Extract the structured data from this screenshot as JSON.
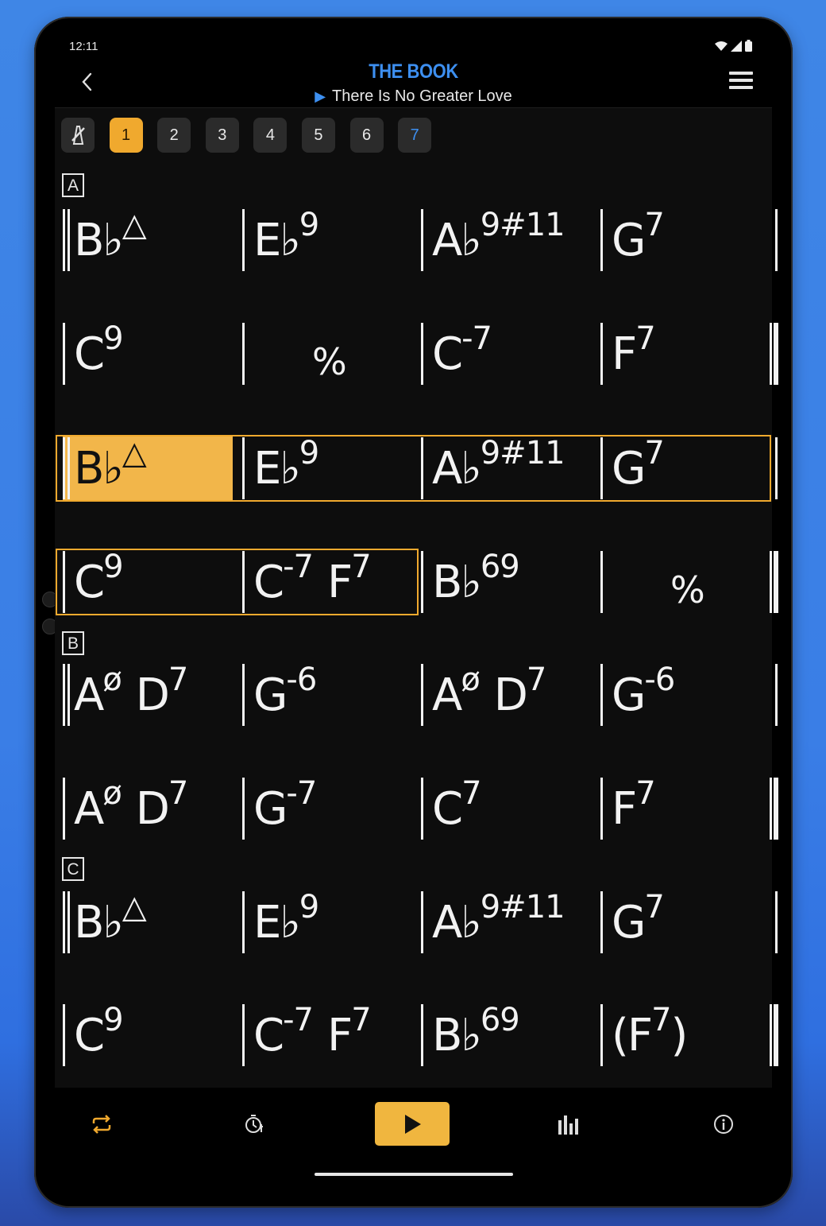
{
  "status": {
    "time": "12:11"
  },
  "header": {
    "title": "THE BOOK",
    "song_title": "There Is No Greater Love"
  },
  "tabs": [
    "1",
    "2",
    "3",
    "4",
    "5",
    "6",
    "7"
  ],
  "active_tab": "1",
  "sections": [
    {
      "label": "A",
      "rows": [
        [
          {
            "root": "Bb",
            "ext": "△"
          },
          {
            "root": "Eb",
            "ext": "9"
          },
          {
            "root": "Ab",
            "ext": "9#11"
          },
          {
            "root": "G",
            "ext": "7"
          }
        ],
        [
          {
            "root": "C",
            "ext": "9"
          },
          {
            "repeat": "%"
          },
          {
            "root": "C",
            "ext": "-7"
          },
          {
            "root": "F",
            "ext": "7"
          }
        ],
        [
          {
            "root": "Bb",
            "ext": "△"
          },
          {
            "root": "Eb",
            "ext": "9"
          },
          {
            "root": "Ab",
            "ext": "9#11"
          },
          {
            "root": "G",
            "ext": "7"
          }
        ],
        [
          {
            "root": "C",
            "ext": "9"
          },
          {
            "root": "C",
            "ext": "-7",
            "root2": "F",
            "ext2": "7"
          },
          {
            "root": "Bb",
            "ext": "69"
          },
          {
            "repeat": "%"
          }
        ]
      ]
    },
    {
      "label": "B",
      "rows": [
        [
          {
            "root": "A",
            "ext": "ø",
            "root2": "D",
            "ext2": "7"
          },
          {
            "root": "G",
            "ext": "-6"
          },
          {
            "root": "A",
            "ext": "ø",
            "root2": "D",
            "ext2": "7"
          },
          {
            "root": "G",
            "ext": "-6"
          }
        ],
        [
          {
            "root": "A",
            "ext": "ø",
            "root2": "D",
            "ext2": "7"
          },
          {
            "root": "G",
            "ext": "-7"
          },
          {
            "root": "C",
            "ext": "7"
          },
          {
            "root": "F",
            "ext": "7"
          }
        ]
      ]
    },
    {
      "label": "C",
      "rows": [
        [
          {
            "root": "Bb",
            "ext": "△"
          },
          {
            "root": "Eb",
            "ext": "9"
          },
          {
            "root": "Ab",
            "ext": "9#11"
          },
          {
            "root": "G",
            "ext": "7"
          }
        ],
        [
          {
            "root": "C",
            "ext": "9"
          },
          {
            "root": "C",
            "ext": "-7",
            "root2": "F",
            "ext2": "7"
          },
          {
            "root": "Bb",
            "ext": "69"
          },
          {
            "root": "(F",
            "ext": "7",
            "close": ")"
          }
        ]
      ]
    }
  ],
  "colors": {
    "accent": "#f0a92e",
    "highlight": "#f2b64a",
    "title_blue": "#3d8ff0",
    "background": "#0d0d0d"
  },
  "icons": {
    "back": "chevron-left-icon",
    "menu": "hamburger-menu-icon",
    "metronome": "metronome-icon",
    "loop": "loop-icon",
    "tempo": "tempo-icon",
    "play": "play-icon",
    "mixer": "mixer-icon",
    "info": "info-icon"
  }
}
